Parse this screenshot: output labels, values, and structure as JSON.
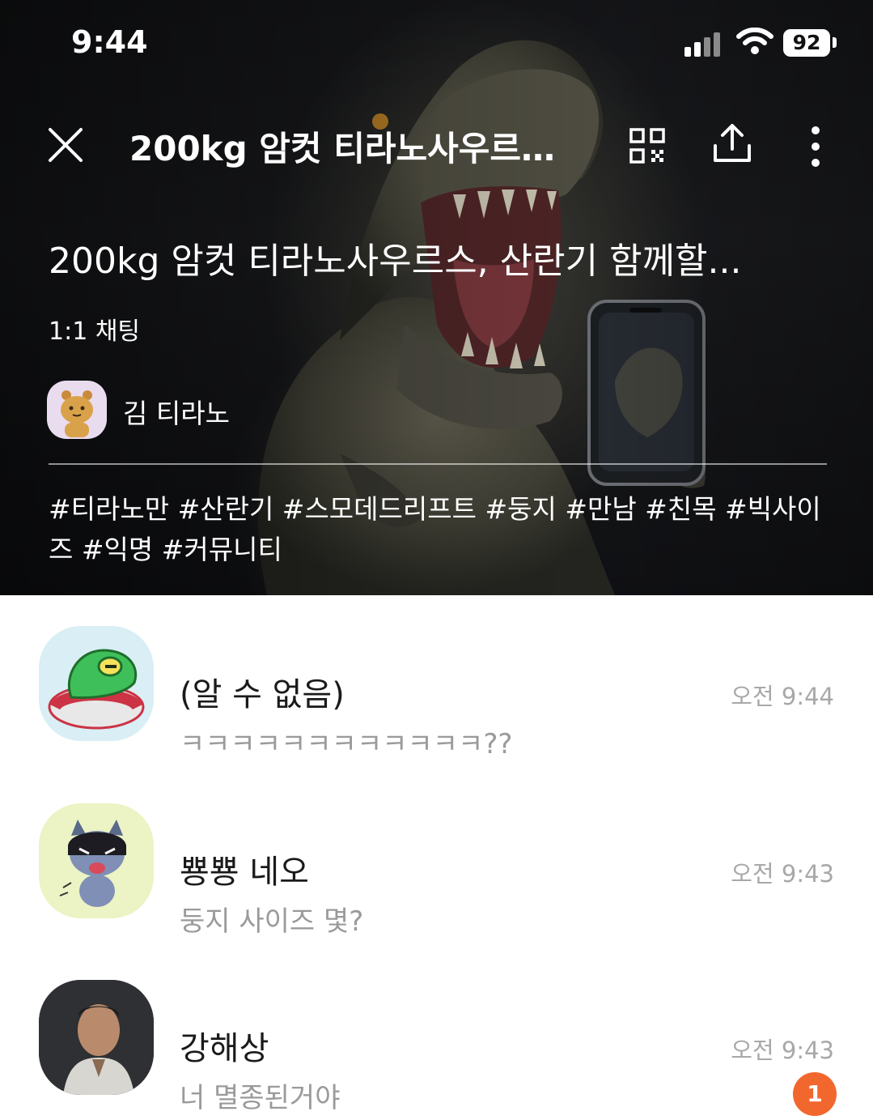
{
  "status_bar": {
    "time": "9:44",
    "battery": "92"
  },
  "header": {
    "title": "200kg 암컷 티라노사우르…"
  },
  "room": {
    "name": "200kg 암컷 티라노사우르스, 산란기 함께할...",
    "type": "1:1 채팅",
    "host": "김 티라노",
    "hashtags": "#티라노만 #산란기 #스모데드리프트 #둥지 #만남 #친목 #빅사이즈 #익명 #커뮤니티"
  },
  "chats": [
    {
      "name": "(알 수 없음)",
      "preview": "ㅋㅋㅋㅋㅋㅋㅋㅋㅋㅋㅋㅋ??",
      "time": "오전 9:44",
      "unread": ""
    },
    {
      "name": "뿅뿅 네오",
      "preview": "둥지 사이즈 몇?",
      "time": "오전 9:43",
      "unread": ""
    },
    {
      "name": "강해상",
      "preview": "너 멸종된거야",
      "time": "오전 9:43",
      "unread": "1"
    }
  ],
  "colors": {
    "accent_badge": "#f2672e",
    "header_bg": "#1b1c1f"
  }
}
